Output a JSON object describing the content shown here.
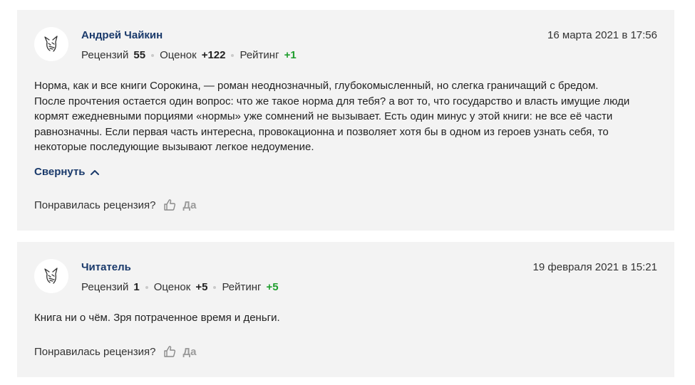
{
  "reviews": [
    {
      "author": "Андрей Чайкин",
      "date": "16 марта 2021 в 17:56",
      "stats": {
        "reviews_label": "Рецензий",
        "reviews_value": "55",
        "ratings_label": "Оценок",
        "ratings_value": "+122",
        "rating_label": "Рейтинг",
        "rating_value": "+1"
      },
      "lines": [
        "Норма, как и все книги Сорокина, — роман неоднозначный, глубокомысленный, но слегка граничащий с бредом.",
        "После прочтения остается один вопрос: что же такое норма для тебя? а вот то, что государство и власть имущие люди",
        "кормят ежедневными порциями «нормы» уже сомнений не вызывает. Есть один минус у этой книги: не все её части",
        "равнозначны. Если первая часть интересна, провокационна и позволяет хотя бы в одном из героев узнать себя, то",
        "некоторые последующие вызывают легкое недоумение."
      ],
      "collapse_label": "Свернуть",
      "helpful_label": "Понравилась рецензия?",
      "yes_label": "Да"
    },
    {
      "author": "Читатель",
      "date": "19 февраля 2021 в 15:21",
      "stats": {
        "reviews_label": "Рецензий",
        "reviews_value": "1",
        "ratings_label": "Оценок",
        "ratings_value": "+5",
        "rating_label": "Рейтинг",
        "rating_value": "+5"
      },
      "lines": [
        "Книга ни о чём. Зря потраченное время и деньги."
      ],
      "helpful_label": "Понравилась рецензия?",
      "yes_label": "Да"
    }
  ],
  "colors": {
    "card_bg": "#f3f3f3",
    "link": "#1a3a6b",
    "positive": "#1e9e2d"
  },
  "icons": {
    "avatar": "default-cat-avatar-icon",
    "collapse": "chevron-up-icon",
    "like": "thumbs-up-icon"
  }
}
